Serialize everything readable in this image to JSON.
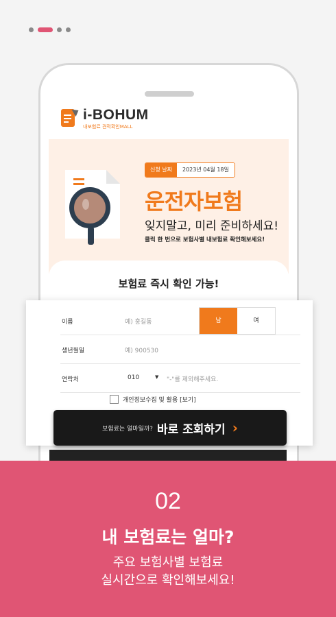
{
  "pagination": {
    "total": 4,
    "active": 1
  },
  "logo": {
    "title": "i-BOHUM",
    "subtitle": "내보험료 견적확인MALL"
  },
  "hero": {
    "badge_label": "신청 날짜",
    "badge_date": "2023년 04월 18일",
    "title": "운전자보험",
    "subtitle": "잊지말고, 미리 준비하세요!",
    "note": "클릭 한 번으로 보험사별 내보험료 확인해보세요!"
  },
  "card": {
    "heading": "보험료 즉시 확인 가능!"
  },
  "form": {
    "name_label": "이름",
    "name_placeholder": "예) 홍길동",
    "gender_male": "남",
    "gender_female": "여",
    "birth_label": "생년월일",
    "birth_placeholder": "예) 900530",
    "phone_label": "연락처",
    "carrier": "010",
    "phone_placeholder": "\"-\"를 제외해주세요.",
    "agree_text": "개인정보수집 및 활용 [보기]"
  },
  "cta": {
    "small": "보험료는 얼마일까?",
    "big": "바로 조회하기",
    "arrow": "›"
  },
  "promo": {
    "step": "02",
    "title": "내 보험료는 얼마?",
    "line1": "주요 보험사별 보험료",
    "line2": "실시간으로 확인해보세요!"
  },
  "colors": {
    "accent": "#f07a1c",
    "pink": "#e05574",
    "dark": "#191919"
  }
}
